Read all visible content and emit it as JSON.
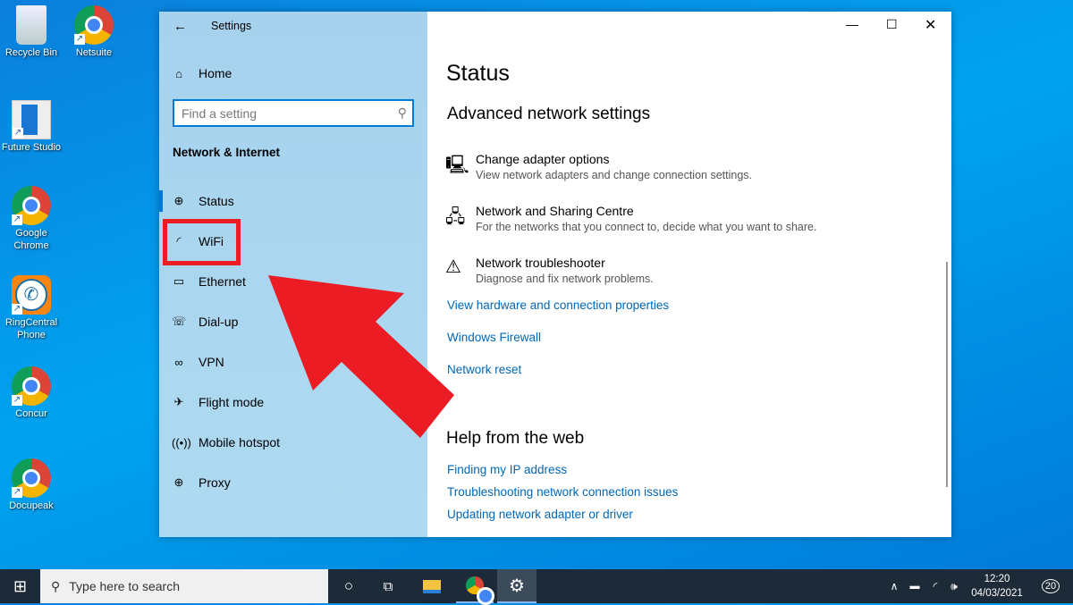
{
  "desktop": {
    "icons": [
      {
        "label": "Recycle Bin",
        "type": "bin"
      },
      {
        "label": "Netsuite",
        "type": "chrome"
      },
      {
        "label": "Future Studio",
        "type": "app"
      },
      {
        "label": "Google Chrome",
        "type": "chrome"
      },
      {
        "label": "RingCentral Phone",
        "type": "phone"
      },
      {
        "label": "Concur",
        "type": "chrome"
      },
      {
        "label": "Docupeak",
        "type": "chrome"
      }
    ]
  },
  "window": {
    "title": "Settings",
    "home": "Home",
    "search_placeholder": "Find a setting",
    "section": "Network & Internet",
    "nav": [
      "Status",
      "WiFi",
      "Ethernet",
      "Dial-up",
      "VPN",
      "Flight mode",
      "Mobile hotspot",
      "Proxy"
    ],
    "page_title": "Status",
    "advanced_heading": "Advanced network settings",
    "items": [
      {
        "title": "Change adapter options",
        "desc": "View network adapters and change connection settings.",
        "icon": "adapter-icon"
      },
      {
        "title": "Network and Sharing Centre",
        "desc": "For the networks that you connect to, decide what you want to share.",
        "icon": "sharing-icon"
      },
      {
        "title": "Network troubleshooter",
        "desc": "Diagnose and fix network problems.",
        "icon": "warning-icon"
      }
    ],
    "links": [
      "View hardware and connection properties",
      "Windows Firewall",
      "Network reset"
    ],
    "help_heading": "Help from the web",
    "help_links": [
      "Finding my IP address",
      "Troubleshooting network connection issues",
      "Updating network adapter or driver"
    ]
  },
  "annotation": {
    "color": "#ec1c24",
    "highlighted": "WiFi"
  },
  "taskbar": {
    "search_placeholder": "Type here to search",
    "time": "12:20",
    "date": "04/03/2021",
    "notifications": "20"
  }
}
